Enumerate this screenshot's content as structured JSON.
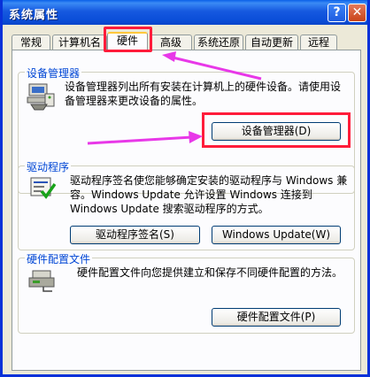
{
  "window": {
    "title": "系统属性"
  },
  "title_buttons": {
    "help": "?",
    "close": "✕"
  },
  "tabs": [
    {
      "label": "常规"
    },
    {
      "label": "计算机名"
    },
    {
      "label": "硬件"
    },
    {
      "label": "高级"
    },
    {
      "label": "系统还原"
    },
    {
      "label": "自动更新"
    },
    {
      "label": "远程"
    }
  ],
  "device_manager": {
    "title": "设备管理器",
    "description": "设备管理器列出所有安装在计算机上的硬件设备。请使用设备管理器来更改设备的属性。",
    "button": "设备管理器(D)"
  },
  "drivers": {
    "title": "驱动程序",
    "description": "驱动程序签名使您能够确定安装的驱动程序与 Windows 兼容。Windows Update 允许设置 Windows 连接到 Windows Update 搜索驱动程序的方式。",
    "button_signing": "驱动程序签名(S)",
    "button_update": "Windows Update(W)"
  },
  "hardware_profiles": {
    "title": "硬件配置文件",
    "description": "硬件配置文件向您提供建立和保存不同硬件配置的方法。",
    "button": "硬件配置文件(P)"
  },
  "colors": {
    "highlight": "#ff1c3a",
    "arrow": "#e838e8"
  }
}
